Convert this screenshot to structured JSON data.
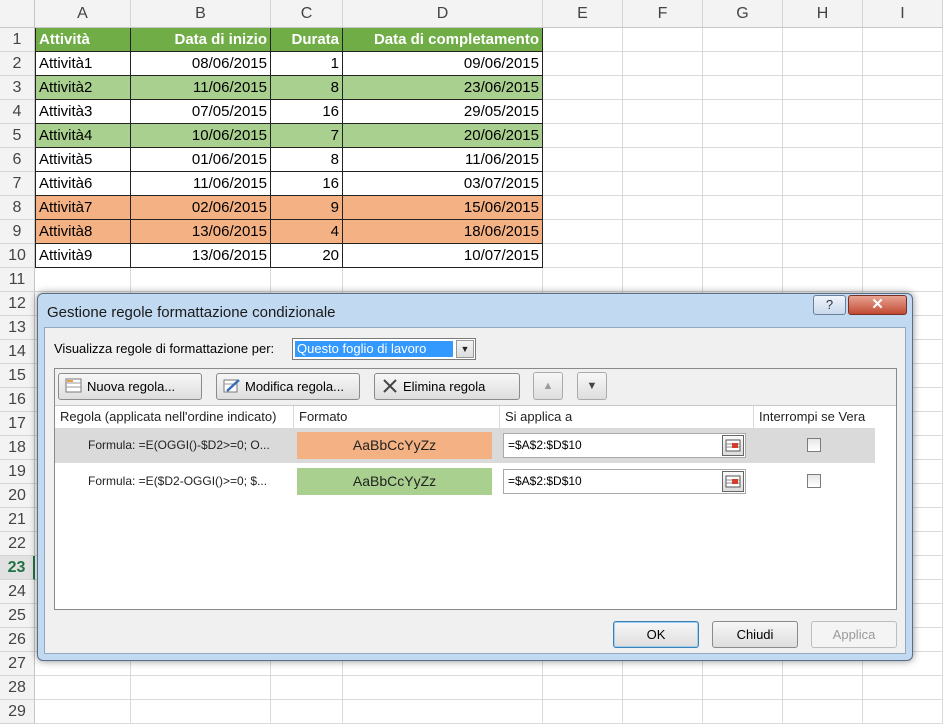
{
  "sheet": {
    "columns": [
      "A",
      "B",
      "C",
      "D",
      "E",
      "F",
      "G",
      "H",
      "I"
    ],
    "rows": [
      "1",
      "2",
      "3",
      "4",
      "5",
      "6",
      "7",
      "8",
      "9",
      "10",
      "11",
      "12",
      "13",
      "14",
      "15",
      "16",
      "17",
      "18",
      "19",
      "20",
      "21",
      "22",
      "23",
      "24",
      "25",
      "26",
      "27",
      "28",
      "29"
    ],
    "active_row": "23",
    "headers": [
      "Attività",
      "Data di inizio",
      "Durata",
      "Data di completamento"
    ],
    "data": [
      {
        "name": "Attività1",
        "start": "08/06/2015",
        "duration": "1",
        "end": "09/06/2015",
        "fill": "none"
      },
      {
        "name": "Attività2",
        "start": "11/06/2015",
        "duration": "8",
        "end": "23/06/2015",
        "fill": "green"
      },
      {
        "name": "Attività3",
        "start": "07/05/2015",
        "duration": "16",
        "end": "29/05/2015",
        "fill": "none"
      },
      {
        "name": "Attività4",
        "start": "10/06/2015",
        "duration": "7",
        "end": "20/06/2015",
        "fill": "green"
      },
      {
        "name": "Attività5",
        "start": "01/06/2015",
        "duration": "8",
        "end": "11/06/2015",
        "fill": "none"
      },
      {
        "name": "Attività6",
        "start": "11/06/2015",
        "duration": "16",
        "end": "03/07/2015",
        "fill": "none"
      },
      {
        "name": "Attività7",
        "start": "02/06/2015",
        "duration": "9",
        "end": "15/06/2015",
        "fill": "orange"
      },
      {
        "name": "Attività8",
        "start": "13/06/2015",
        "duration": "4",
        "end": "18/06/2015",
        "fill": "orange"
      },
      {
        "name": "Attività9",
        "start": "13/06/2015",
        "duration": "20",
        "end": "10/07/2015",
        "fill": "none"
      }
    ],
    "colors": {
      "header": "#70ad47",
      "green": "#a9d08e",
      "orange": "#f4b183"
    }
  },
  "dialog": {
    "title": "Gestione regole formattazione condizionale",
    "help_label": "?",
    "close_label": "✕",
    "show_rules_label": "Visualizza regole di formattazione per:",
    "show_rules_value": "Questo foglio di lavoro",
    "toolbar": {
      "new_rule": "Nuova regola...",
      "edit_rule": "Modifica regola...",
      "delete_rule": "Elimina regola",
      "move_up_icon": "arrow-up-icon",
      "move_down_icon": "arrow-down-icon"
    },
    "table_headers": {
      "rule": "Regola (applicata nell'ordine indicato)",
      "format": "Formato",
      "applies_to": "Si applica a",
      "stop_if_true": "Interrompi se Vera"
    },
    "rules": [
      {
        "formula": "Formula: =E(OGGI()-$D2>=0; O...",
        "preview": "AaBbCcYyZz",
        "color": "#f4b183",
        "range": "=$A$2:$D$10",
        "stop": false
      },
      {
        "formula": "Formula: =E($D2-OGGI()>=0; $...",
        "preview": "AaBbCcYyZz",
        "color": "#a9d08e",
        "range": "=$A$2:$D$10",
        "stop": false
      }
    ],
    "buttons": {
      "ok": "OK",
      "close": "Chiudi",
      "apply": "Applica"
    }
  }
}
